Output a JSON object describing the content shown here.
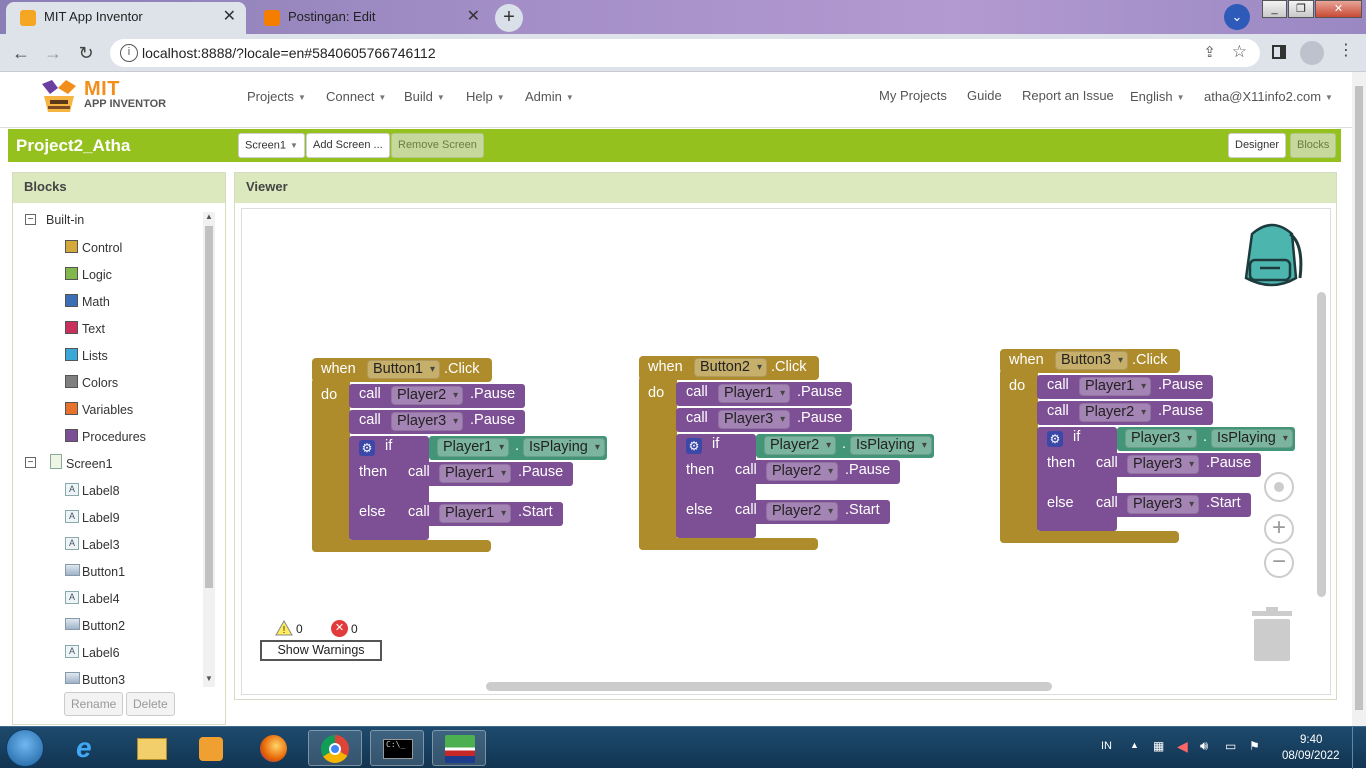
{
  "browser": {
    "tabs": [
      {
        "title": "MIT App Inventor",
        "active": true,
        "favicon_color": "#f18f1f"
      },
      {
        "title": "Postingan: Edit",
        "active": false,
        "favicon_color": "#f57d00"
      }
    ],
    "url": "localhost:8888/?locale=en#5840605766746112",
    "close_glyph": "✕",
    "newtab_glyph": "+"
  },
  "header": {
    "logo_line1": "MIT",
    "logo_line2": "APP INVENTOR",
    "menus": [
      "Projects",
      "Connect",
      "Build",
      "Help",
      "Admin"
    ],
    "right_links": [
      "My Projects",
      "Guide",
      "Report an Issue"
    ],
    "language": "English",
    "account": "atha@X11info2.com"
  },
  "toolbar": {
    "project_name": "Project2_Atha",
    "screen_select": "Screen1",
    "add_screen": "Add Screen ...",
    "remove_screen": "Remove Screen",
    "designer": "Designer",
    "blocks": "Blocks",
    "accent": "#95c11f"
  },
  "blocks_panel": {
    "title": "Blocks",
    "builtin_label": "Built-in",
    "builtin": [
      {
        "label": "Control",
        "color": "#d4a93b"
      },
      {
        "label": "Logic",
        "color": "#82b74b"
      },
      {
        "label": "Math",
        "color": "#3b6fb5"
      },
      {
        "label": "Text",
        "color": "#c9305d"
      },
      {
        "label": "Lists",
        "color": "#3aa9d8"
      },
      {
        "label": "Colors",
        "color": "#7f7f7f"
      },
      {
        "label": "Variables",
        "color": "#e6722e"
      },
      {
        "label": "Procedures",
        "color": "#7a4f95"
      }
    ],
    "screen_label": "Screen1",
    "components": [
      {
        "label": "Label8",
        "kind": "label"
      },
      {
        "label": "Label9",
        "kind": "label"
      },
      {
        "label": "Label3",
        "kind": "label"
      },
      {
        "label": "Button1",
        "kind": "button"
      },
      {
        "label": "Label4",
        "kind": "label"
      },
      {
        "label": "Button2",
        "kind": "button"
      },
      {
        "label": "Label6",
        "kind": "label"
      },
      {
        "label": "Button3",
        "kind": "button"
      }
    ],
    "rename": "Rename",
    "delete": "Delete"
  },
  "viewer": {
    "title": "Viewer",
    "kw": {
      "when": "when",
      "do": "do",
      "call": "call",
      "if": "if",
      "then": "then",
      "else": "else",
      "click": ".Click",
      "pause": ".Pause",
      "start": ".Start",
      "isplaying": "IsPlaying",
      "dot": "."
    },
    "events": [
      {
        "button": "Button1",
        "calls": [
          "Player2",
          "Player3"
        ],
        "cond": "Player1",
        "then_target": "Player1",
        "else_target": "Player1"
      },
      {
        "button": "Button2",
        "calls": [
          "Player1",
          "Player3"
        ],
        "cond": "Player2",
        "then_target": "Player2",
        "else_target": "Player2"
      },
      {
        "button": "Button3",
        "calls": [
          "Player1",
          "Player2"
        ],
        "cond": "Player3",
        "then_target": "Player3",
        "else_target": "Player3"
      }
    ],
    "warnings_count": "0",
    "errors_count": "0",
    "show_warnings": "Show Warnings",
    "block_colors": {
      "event": "#ae8c2c",
      "procedure": "#7d4f94",
      "component": "#439577"
    }
  },
  "taskbar": {
    "lang": "IN",
    "time": "9:40",
    "date": "08/09/2022"
  }
}
